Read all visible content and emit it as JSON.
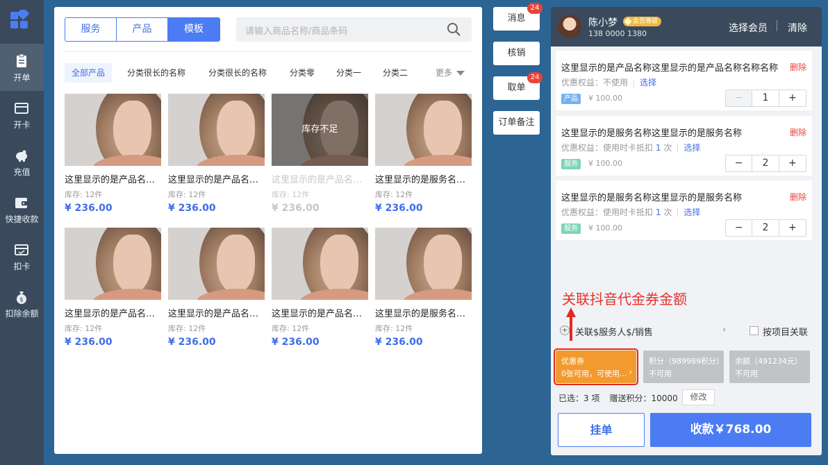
{
  "nav": {
    "items": [
      {
        "label": "开单",
        "icon": "clipboard-icon",
        "active": true
      },
      {
        "label": "开卡",
        "icon": "card-icon",
        "active": false
      },
      {
        "label": "充值",
        "icon": "piggy-bank-icon",
        "active": false
      },
      {
        "label": "快捷收款",
        "icon": "wallet-icon",
        "active": false
      },
      {
        "label": "扣卡",
        "icon": "card-deduct-icon",
        "active": false
      },
      {
        "label": "扣除余额",
        "icon": "money-bag-icon",
        "active": false
      }
    ]
  },
  "catalog": {
    "tabs": [
      "服务",
      "产品",
      "模板"
    ],
    "active_tab": "模板",
    "search_placeholder": "请输入商品名称/商品条码",
    "categories": [
      "全部产品",
      "分类很长的名称",
      "分类很长的名称",
      "分类零",
      "分类一",
      "分类二"
    ],
    "more_label": "更多",
    "products": [
      {
        "name": "这里显示的是产品名称这里显示的是产品名称",
        "stock": "库存: 12件",
        "price": "¥ 236.00",
        "out_of_stock": false
      },
      {
        "name": "这里显示的是产品名称这里显示的是产品名称",
        "stock": "库存: 12件",
        "price": "¥ 236.00",
        "out_of_stock": false
      },
      {
        "name": "这里显示的是产品名称这里显示的是产品名称",
        "stock": "库存: 12件",
        "price": "¥ 236.00",
        "out_of_stock": true,
        "overlay": "库存不足"
      },
      {
        "name": "这里显示的是服务名称这里显示的是服务名称",
        "stock": "库存: 12件",
        "price": "¥ 236.00",
        "out_of_stock": false
      },
      {
        "name": "这里显示的是产品名称这里显示的是产品名称",
        "stock": "库存: 12件",
        "price": "¥ 236.00",
        "out_of_stock": false
      },
      {
        "name": "这里显示的是产品名称这里显示的是产品名称",
        "stock": "库存: 12件",
        "price": "¥ 236.00",
        "out_of_stock": false
      },
      {
        "name": "这里显示的是产品名称这里显示的是产品名称",
        "stock": "库存: 12件",
        "price": "¥ 236.00",
        "out_of_stock": false
      },
      {
        "name": "这里显示的是服务名称这里显示的是服务名称",
        "stock": "库存: 12件",
        "price": "¥ 236.00",
        "out_of_stock": false
      }
    ]
  },
  "actions": [
    {
      "label": "消息",
      "badge": "24"
    },
    {
      "label": "核销",
      "badge": ""
    },
    {
      "label": "取单",
      "badge": "24"
    },
    {
      "label": "订单备注",
      "badge": ""
    }
  ],
  "member": {
    "name": "陈小梦",
    "level": "会员等级",
    "phone": "138 0000 1380",
    "select_label": "选择会员",
    "clear_label": "清除"
  },
  "cart": {
    "items": [
      {
        "title": "这里显示的是产品名称这里显示的是产品名称名称名称",
        "delete_label": "删除",
        "discount_prefix": "优惠权益：不使用",
        "discount_count": "",
        "discount_suffix": "",
        "select_label": "选择",
        "type": "产品",
        "price": "¥ 100.00",
        "qty": "1"
      },
      {
        "title": "这里显示的是服务名称这里显示的是服务名称",
        "delete_label": "删除",
        "discount_prefix": "优惠权益：使用时卡抵扣",
        "discount_count": "1",
        "discount_suffix": "次",
        "select_label": "选择",
        "type": "服务",
        "price": "¥ 100.00",
        "qty": "2"
      },
      {
        "title": "这里显示的是服务名称这里显示的是服务名称",
        "delete_label": "删除",
        "discount_prefix": "优惠权益：使用时卡抵扣",
        "discount_count": "1",
        "discount_suffix": "次",
        "select_label": "选择",
        "type": "服务",
        "price": "¥ 100.00",
        "qty": "2"
      }
    ],
    "annotation": "关联抖音代金券金额",
    "assoc_label": "关联$服务人$/销售",
    "by_item_label": "按项目关联",
    "payment": {
      "coupon": {
        "title": "优惠券",
        "detail": "0张可用，可使用..."
      },
      "points": {
        "title": "积分（989989积分）",
        "detail": "不可用"
      },
      "balance": {
        "title": "余额（491234元）",
        "detail": "不可用"
      }
    },
    "summary": {
      "selected": "已选：3 项",
      "bonus_points": "赠送积分：10000",
      "edit_label": "修改"
    },
    "hold_label": "挂单",
    "checkout_label": "收款￥768.00"
  },
  "colors": {
    "accent": "#4b7cf3",
    "danger": "#e8433a",
    "coupon": "#f39a2e",
    "nav_bg": "#3a4a5c",
    "page_bg": "#2c6493"
  }
}
